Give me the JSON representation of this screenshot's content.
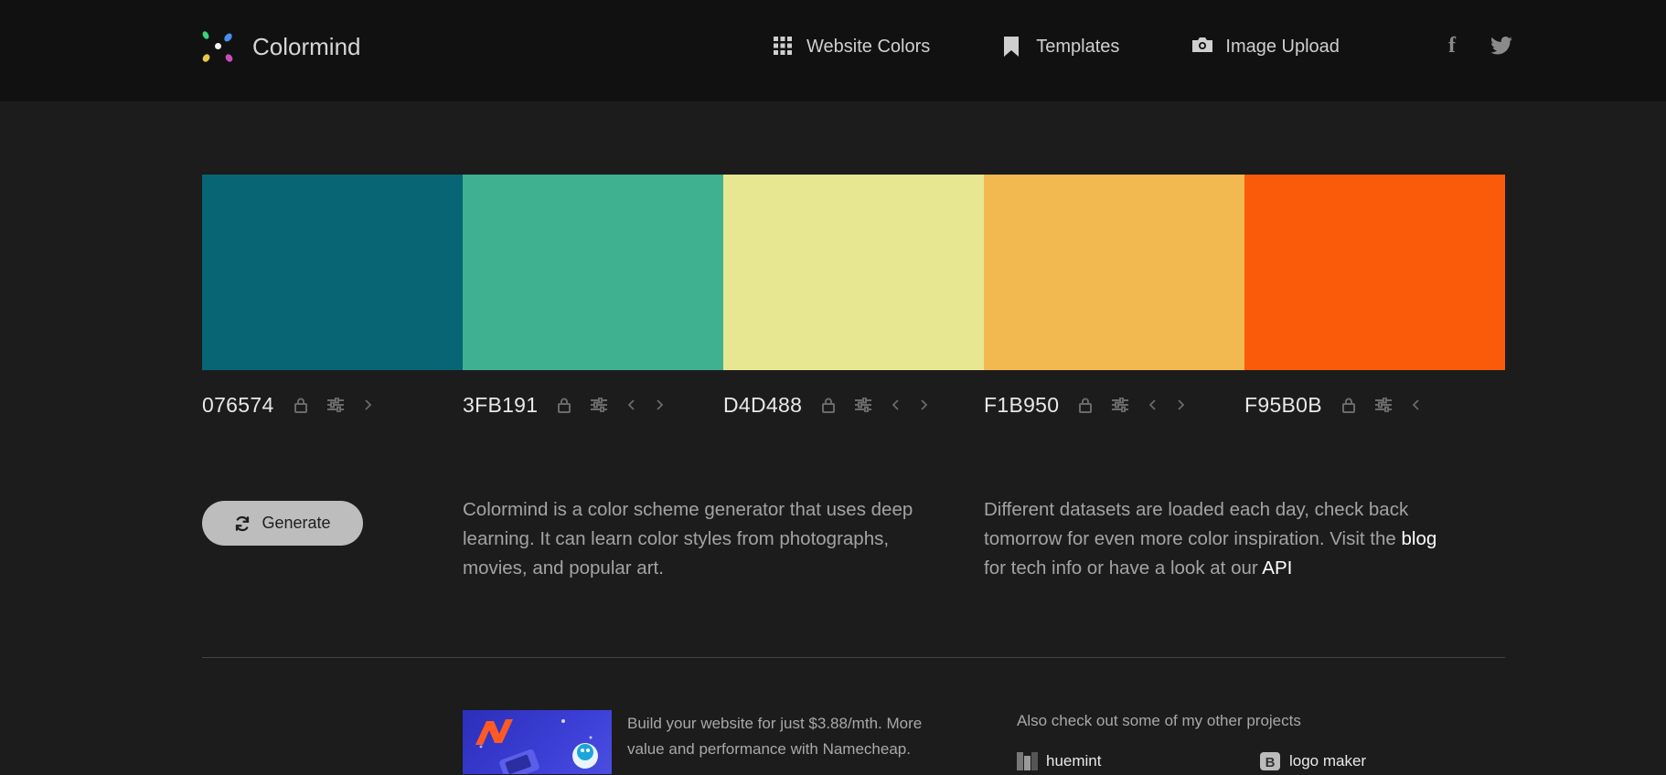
{
  "header": {
    "brand": "Colormind",
    "nav": [
      {
        "label": "Website Colors",
        "icon": "grid-icon"
      },
      {
        "label": "Templates",
        "icon": "bookmark-icon"
      },
      {
        "label": "Image Upload",
        "icon": "camera-icon"
      }
    ],
    "social": [
      {
        "icon": "facebook-icon",
        "glyph": "f"
      },
      {
        "icon": "twitter-icon"
      }
    ]
  },
  "palette": {
    "swatches": [
      {
        "hex": "076574",
        "color": "#076574"
      },
      {
        "hex": "3FB191",
        "color": "#3FB191"
      },
      {
        "hex": "D4D488",
        "color": "#E8E791"
      },
      {
        "hex": "F1B950",
        "color": "#F1B950"
      },
      {
        "hex": "F95B0B",
        "color": "#F95B0B"
      }
    ]
  },
  "actions": {
    "generate_label": "Generate"
  },
  "about": {
    "left_text": "Colormind is a color scheme generator that uses deep learning. It can learn color styles from photographs, movies, and popular art.",
    "right_text_1": "Different datasets are loaded each day, check back tomorrow for even more color inspiration. Visit the",
    "blog_link": "blog",
    "right_text_2": " for tech info or have a look at our ",
    "api_link": "API"
  },
  "footer": {
    "ad_text": "Build your website for just $3.88/mth. More value and performance with Namecheap.",
    "projects_title": "Also check out some of my other projects",
    "projects": [
      {
        "label": "huemint",
        "icon": "huemint-icon"
      },
      {
        "label": "logo maker",
        "icon": "logo-maker-icon"
      }
    ]
  }
}
